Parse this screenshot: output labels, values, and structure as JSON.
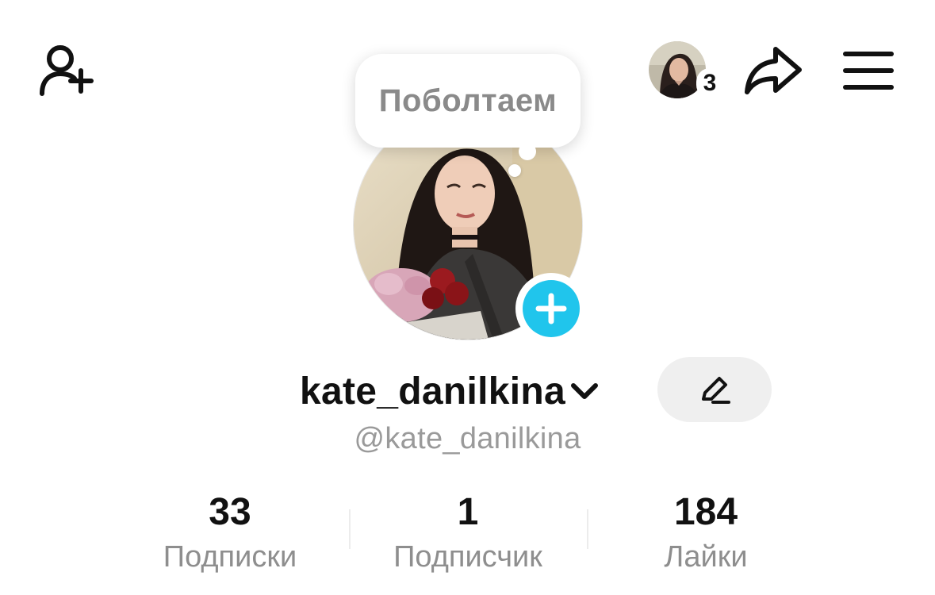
{
  "header": {
    "add_friend_icon": "person-plus-icon",
    "mini_avatar_count": "3",
    "share_icon": "share-arrow-icon",
    "menu_icon": "hamburger-menu-icon"
  },
  "bubble": {
    "text": "Поболтаем"
  },
  "profile": {
    "username": "kate_danilkina",
    "handle": "@kate_danilkina",
    "edit_icon": "pencil-icon",
    "add_icon": "plus-icon",
    "accent": "#20c5ec"
  },
  "stats": [
    {
      "value": "33",
      "label": "Подписки"
    },
    {
      "value": "1",
      "label": "Подписчик"
    },
    {
      "value": "184",
      "label": "Лайки"
    }
  ]
}
